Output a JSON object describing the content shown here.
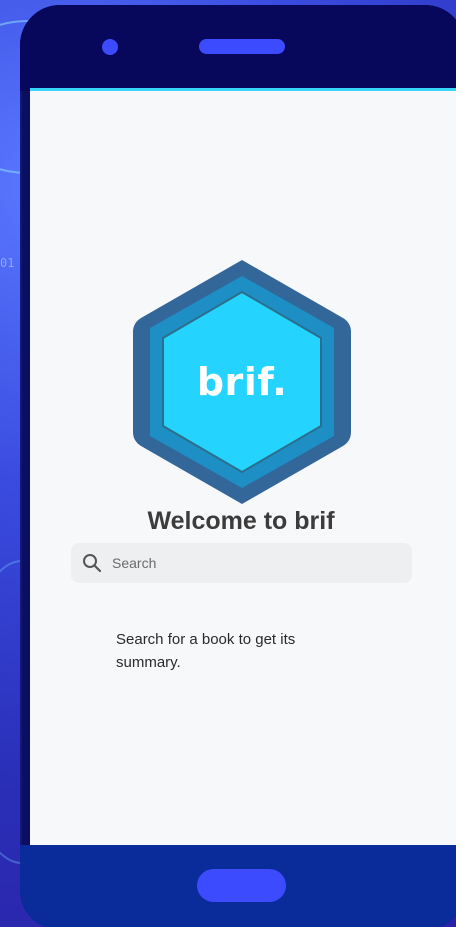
{
  "background": {
    "code_fragment": "01"
  },
  "app": {
    "logo_text": "brif.",
    "welcome_title": "Welcome to brif",
    "search": {
      "placeholder": "Search",
      "value": ""
    },
    "help_text": "Search for a book to get its summary."
  },
  "colors": {
    "logo_outer": "#336699",
    "logo_middle": "#1d8fc4",
    "logo_inner": "#24d4fe",
    "accent": "#3d4bff",
    "phone_body": "#0a0f62",
    "screen_bg": "#f7f8fa"
  },
  "icons": {
    "search": "search-icon",
    "logo": "hexagon-logo-icon"
  }
}
